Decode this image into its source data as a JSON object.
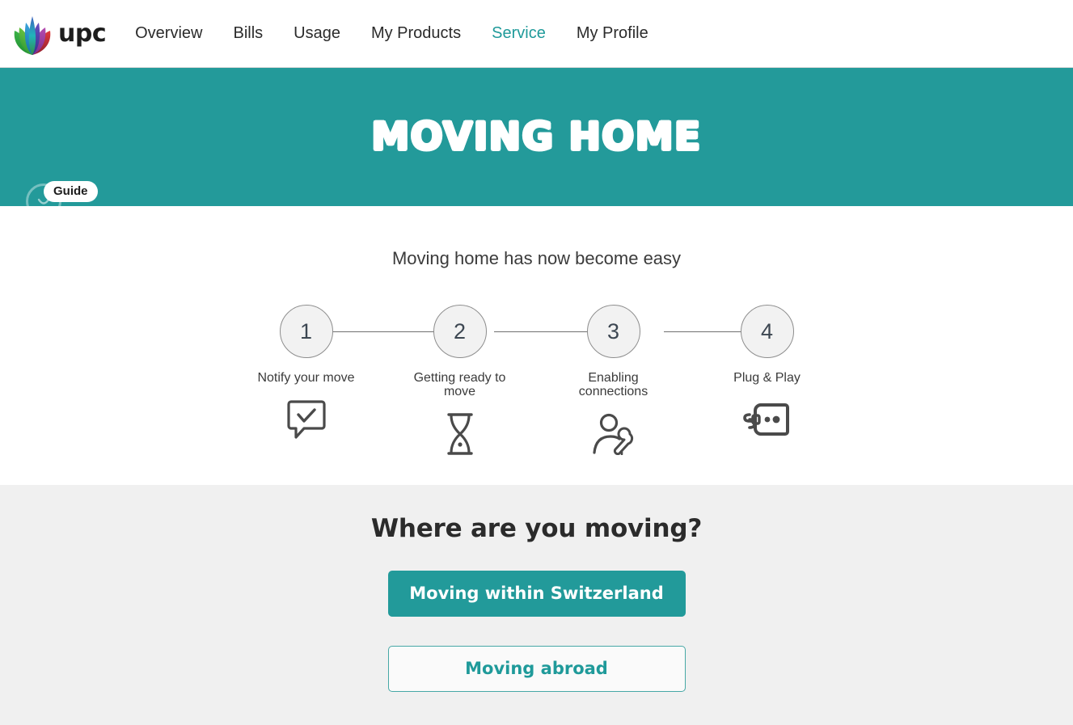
{
  "header": {
    "logo": {
      "icon": "upc-flower-logo-icon",
      "wordmark": "upc"
    },
    "nav": [
      {
        "label": "Overview",
        "active": false
      },
      {
        "label": "Bills",
        "active": false
      },
      {
        "label": "Usage",
        "active": false
      },
      {
        "label": "My Products",
        "active": false
      },
      {
        "label": "Service",
        "active": true
      },
      {
        "label": "My Profile",
        "active": false
      }
    ]
  },
  "hero": {
    "title": "MOVING HOME",
    "background_color": "#239a9a",
    "guide": {
      "badge_label": "Guide",
      "icon": "guide-smile-circle-icon"
    }
  },
  "steps_section": {
    "lead_text": "Moving home has now become easy",
    "steps": [
      {
        "number": "1",
        "label": "Notify your move",
        "icon": "speech-bubble-check-icon"
      },
      {
        "number": "2",
        "label": "Getting ready to move",
        "icon": "hourglass-icon"
      },
      {
        "number": "3",
        "label": "Enabling connections",
        "icon": "technician-wrench-icon"
      },
      {
        "number": "4",
        "label": "Plug & Play",
        "icon": "plug-socket-icon"
      }
    ]
  },
  "choice_section": {
    "title": "Where are you moving?",
    "primary_button": "Moving within Switzerland",
    "secondary_button": "Moving abroad",
    "accent_color": "#229a9a",
    "background_color": "#f0f0f0"
  }
}
